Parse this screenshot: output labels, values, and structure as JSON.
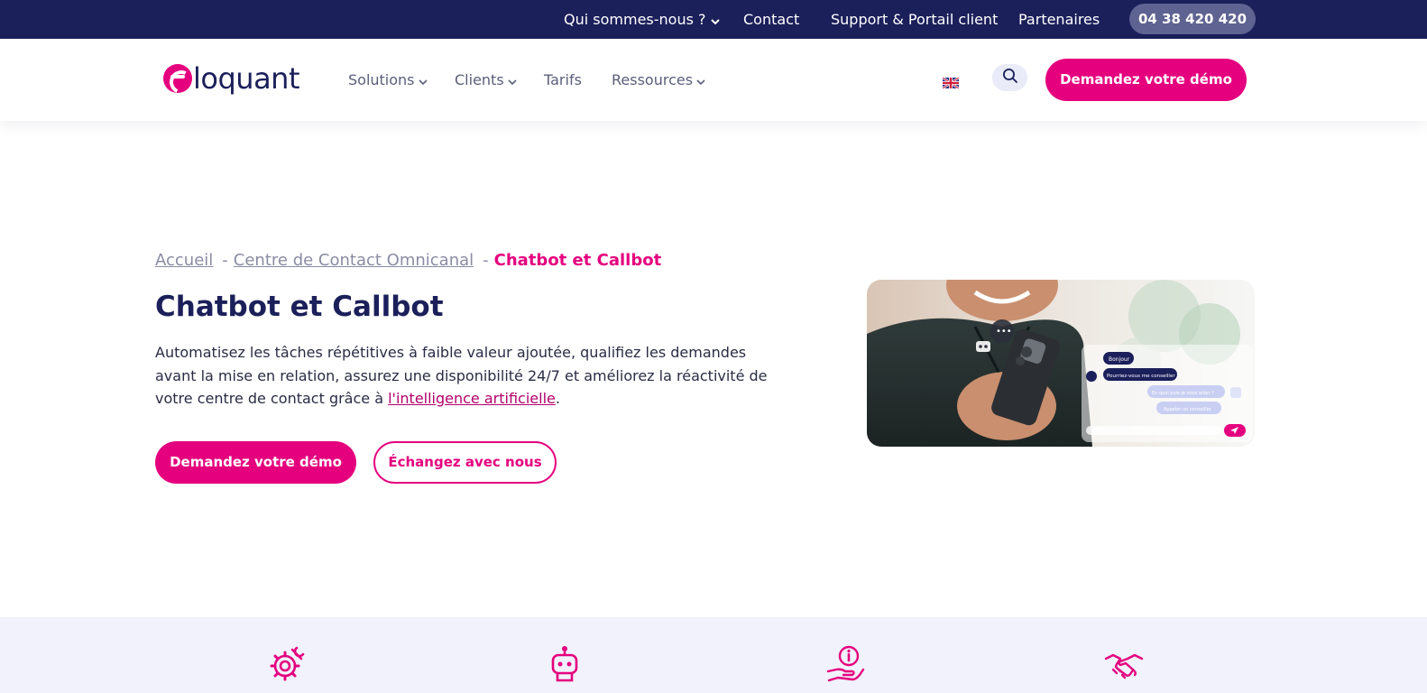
{
  "topbar": {
    "items": [
      {
        "label": "Qui sommes-nous ?",
        "has_chevron": true
      },
      {
        "label": "Contact"
      },
      {
        "label": "Support & Portail client"
      },
      {
        "label": "Partenaires"
      }
    ],
    "phone": "04 38 420 420"
  },
  "header": {
    "logo_text": "loquant",
    "nav": [
      {
        "label": "Solutions",
        "has_chevron": true
      },
      {
        "label": "Clients",
        "has_chevron": true
      },
      {
        "label": "Tarifs",
        "has_chevron": false
      },
      {
        "label": "Ressources",
        "has_chevron": true
      }
    ],
    "cta": "Demandez votre démo",
    "language_icon": "uk-flag-icon",
    "search_icon": "search-icon"
  },
  "breadcrumb": {
    "items": [
      "Accueil",
      "Centre de Contact Omnicanal"
    ],
    "separator": "-",
    "current": "Chatbot et Callbot"
  },
  "hero": {
    "title": "Chatbot et Callbot",
    "intro_before_link": "Automatisez les tâches répétitives à faible valeur ajoutée, qualifiez les demandes avant la mise en relation, assurez une disponibilité 24/7 et améliorez la réactivité de votre centre de contact grâce à ",
    "intro_link": "l'intelligence artificielle",
    "intro_after_link": ".",
    "primary_button": "Demandez votre démo",
    "secondary_button": "Échangez avec nous",
    "image_chat": {
      "bubble_1": "Bonjour",
      "bubble_2": "Pourriez-vous me conseiller ?",
      "bubble_3": "En quoi puis-je vous aider ?",
      "bubble_4": "Appeler un conseiller"
    }
  },
  "features": {
    "icons": [
      "gear-wrench-icon",
      "robot-icon",
      "hand-info-icon",
      "handshake-icon"
    ]
  },
  "colors": {
    "brand_pink": "#e5007e",
    "navy": "#1b1f5a",
    "feature_bg": "#f1f2fc"
  }
}
